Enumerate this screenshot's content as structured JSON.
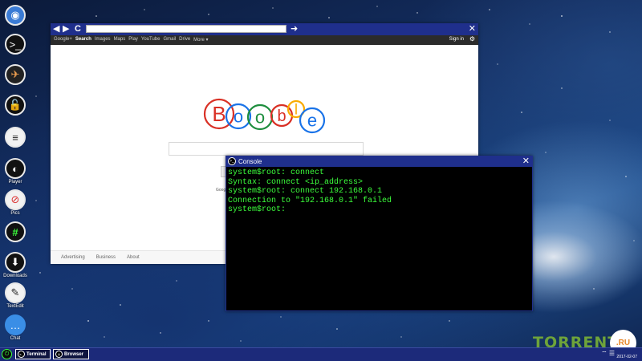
{
  "desktop_icons": [
    {
      "name": "globe-icon",
      "label": ""
    },
    {
      "name": "terminal-icon",
      "label": ""
    },
    {
      "name": "mail-icon",
      "label": ""
    },
    {
      "name": "lock-icon",
      "label": ""
    },
    {
      "name": "document-icon",
      "label": ""
    },
    {
      "name": "player-icon",
      "label": "Player"
    },
    {
      "name": "no-image-icon",
      "label": "Pics"
    },
    {
      "name": "hash-icon",
      "label": ""
    },
    {
      "name": "download-icon",
      "label": "Downloads"
    },
    {
      "name": "notepad-icon",
      "label": "TextEdit"
    },
    {
      "name": "chat-icon",
      "label": "Chat"
    }
  ],
  "browser": {
    "url": "",
    "nav_links": [
      "Google+",
      "Search",
      "Images",
      "Maps",
      "Play",
      "YouTube",
      "Gmail",
      "Drive",
      "More ▾"
    ],
    "active_link": "Search",
    "sign_in": "Sign in",
    "logo_letters": [
      {
        "ch": "B",
        "color": "#d93025"
      },
      {
        "ch": "o",
        "color": "#1a73e8"
      },
      {
        "ch": "o",
        "color": "#1e8e3e"
      },
      {
        "ch": "b",
        "color": "#d93025"
      },
      {
        "ch": "l",
        "color": "#f9ab00"
      },
      {
        "ch": "e",
        "color": "#1a73e8"
      }
    ],
    "partial_label": "Goog",
    "footer_links": [
      "Advertising",
      "Business",
      "About"
    ]
  },
  "console": {
    "title": "Console",
    "lines": [
      "system$root: connect",
      "Syntax: connect <ip_address>",
      "system$root: connect 192.168.0.1",
      "Connection to \"192.168.0.1\" failed",
      "system$root:"
    ],
    "text_color": "#3cff3c"
  },
  "taskbar": {
    "buttons": [
      {
        "name": "terminal",
        "label": "Terminal"
      },
      {
        "name": "browser",
        "label": "Browser"
      }
    ],
    "date": "2017-02-07"
  },
  "watermark": {
    "text": "TORRENT",
    "suffix": ".RU"
  }
}
